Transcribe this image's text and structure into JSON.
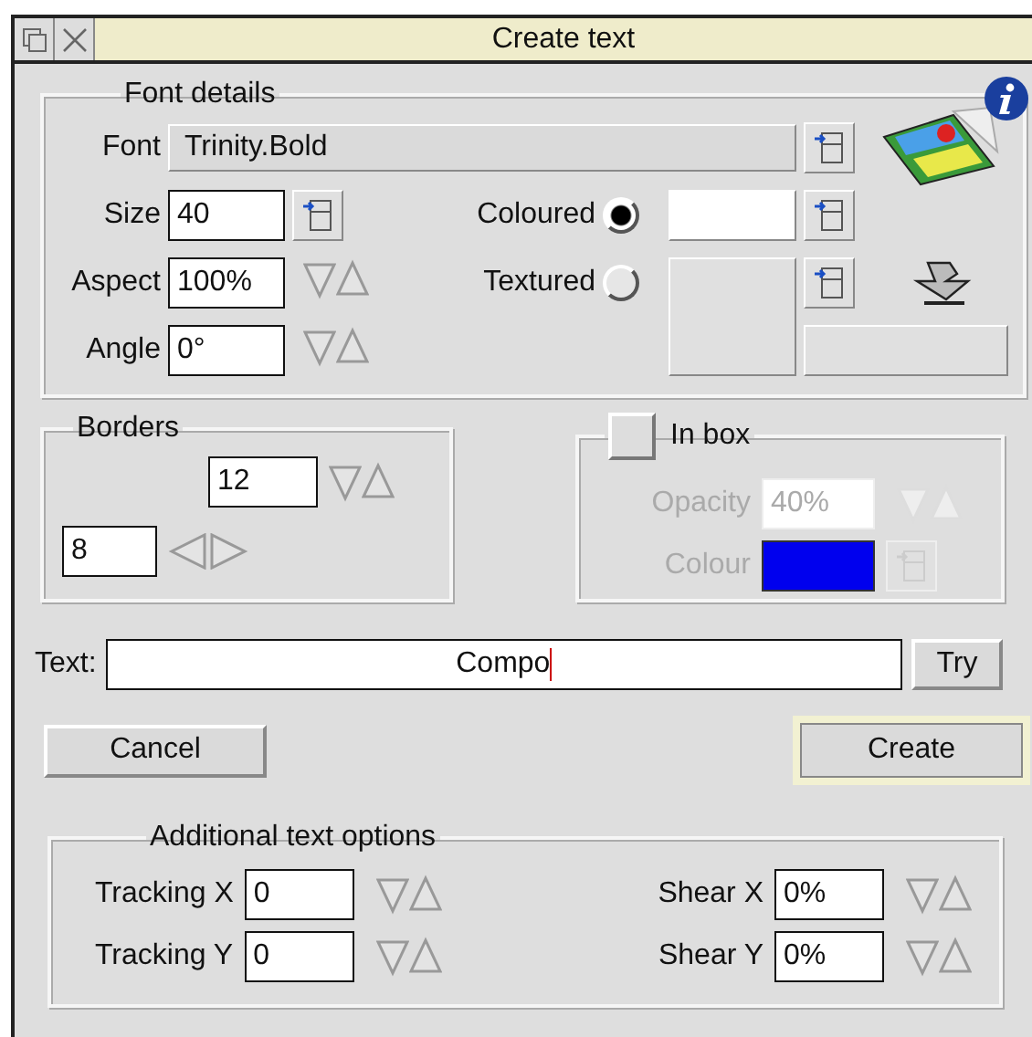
{
  "window": {
    "title": "Create text"
  },
  "font_details": {
    "title": "Font details",
    "font": {
      "label": "Font",
      "value": "Trinity.Bold"
    },
    "size": {
      "label": "Size",
      "value": "40"
    },
    "aspect": {
      "label": "Aspect",
      "value": "100%"
    },
    "angle": {
      "label": "Angle",
      "value": "0°"
    },
    "fill_modes": [
      {
        "label": "Coloured",
        "selected": true,
        "color": "#ffffff"
      },
      {
        "label": "Textured",
        "selected": false
      }
    ]
  },
  "borders": {
    "title": "Borders",
    "vertical": "12",
    "horizontal": "8"
  },
  "in_box": {
    "label": "In box",
    "checked": false,
    "opacity": {
      "label": "Opacity",
      "value": "40%"
    },
    "colour": {
      "label": "Colour",
      "color": "#0000ee"
    }
  },
  "text": {
    "label": "Text:",
    "value": "Compo"
  },
  "try_button": "Try",
  "buttons": [
    {
      "label": "Cancel",
      "default": false
    },
    {
      "label": "Create",
      "default": true
    }
  ],
  "additional": {
    "title": "Additional text options",
    "options": [
      {
        "label": "Tracking X",
        "value": "0"
      },
      {
        "label": "Shear X",
        "value": "0%"
      },
      {
        "label": "Tracking Y",
        "value": "0"
      },
      {
        "label": "Shear Y",
        "value": "0%"
      }
    ]
  }
}
